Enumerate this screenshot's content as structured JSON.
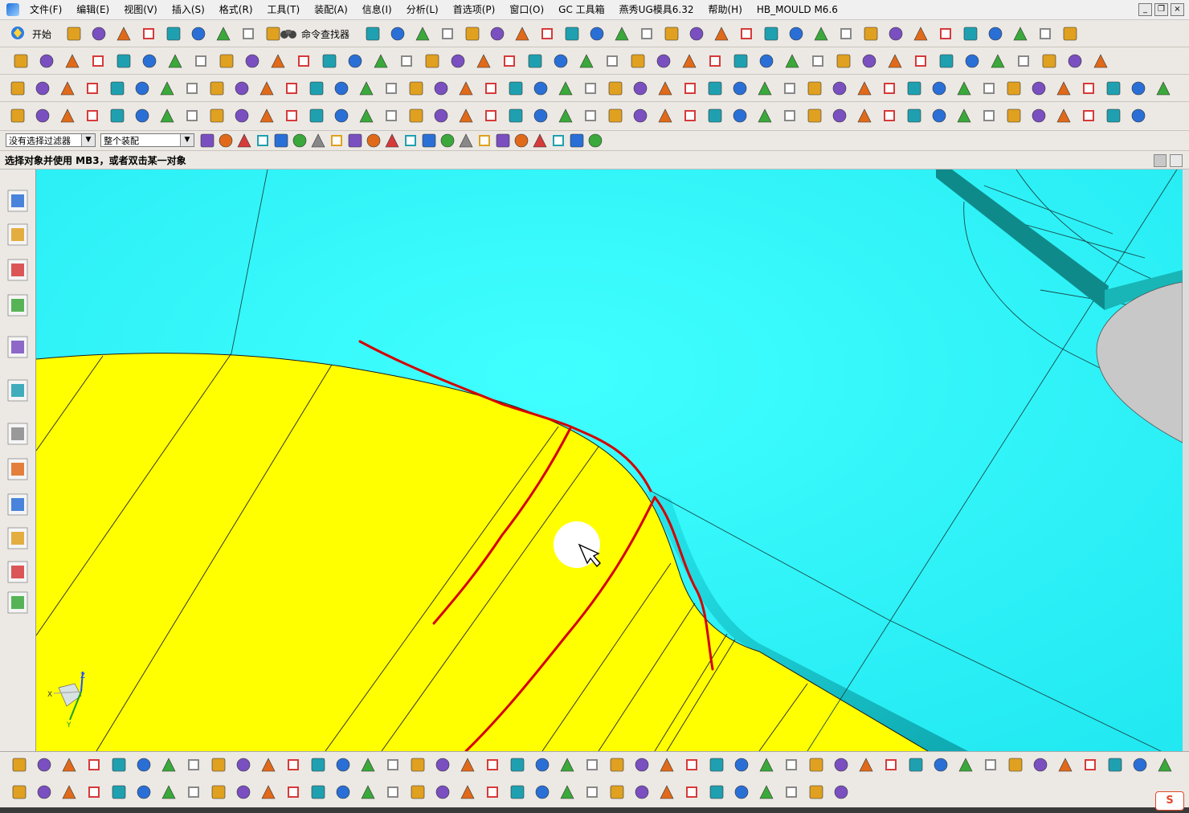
{
  "menubar": {
    "items": [
      "文件(F)",
      "编辑(E)",
      "视图(V)",
      "插入(S)",
      "格式(R)",
      "工具(T)",
      "装配(A)",
      "信息(I)",
      "分析(L)",
      "首选项(P)",
      "窗口(O)",
      "GC 工具箱",
      "燕秀UG模具6.32",
      "帮助(H)",
      "HB_MOULD M6.6"
    ]
  },
  "toolbar": {
    "start_label": "开始",
    "finder_label": "命令查找器"
  },
  "filters": {
    "selection_filter": "没有选择过滤器",
    "scope": "整个装配"
  },
  "status": {
    "prompt": "选择对象并使用 MB3，或者双击某一对象"
  },
  "ime": {
    "label": "S"
  },
  "triad": {
    "z": "Z",
    "x": "X",
    "y": "Y"
  },
  "colors": {
    "surface_cyan": "#2ef7f7",
    "surface_yellow": "#ffff00",
    "annotation_red": "#d40000",
    "hole_gray": "#c8c8c8"
  }
}
